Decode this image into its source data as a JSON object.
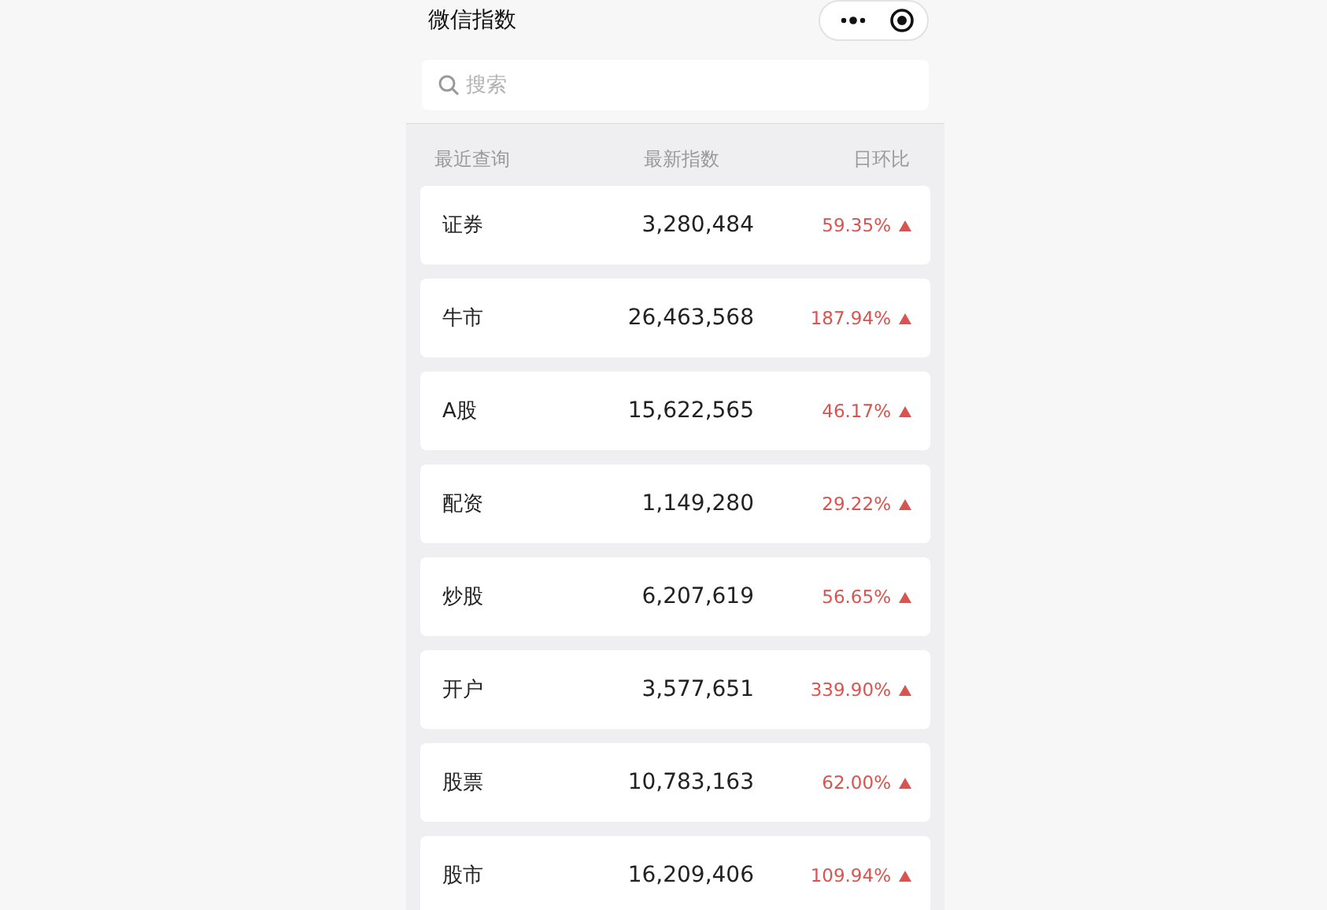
{
  "header": {
    "title": "微信指数"
  },
  "search": {
    "placeholder": "搜索"
  },
  "columns": [
    "最近查询",
    "最新指数",
    "日环比"
  ],
  "rows": [
    {
      "name": "证券",
      "index": "3,280,484",
      "change": "59.35%",
      "kind": "up"
    },
    {
      "name": "牛市",
      "index": "26,463,568",
      "change": "187.94%",
      "kind": "up"
    },
    {
      "name": "A股",
      "index": "15,622,565",
      "change": "46.17%",
      "kind": "up"
    },
    {
      "name": "配资",
      "index": "1,149,280",
      "change": "29.22%",
      "kind": "up"
    },
    {
      "name": "炒股",
      "index": "6,207,619",
      "change": "56.65%",
      "kind": "up"
    },
    {
      "name": "开户",
      "index": "3,577,651",
      "change": "339.90%",
      "kind": "up"
    },
    {
      "name": "股票",
      "index": "10,783,163",
      "change": "62.00%",
      "kind": "up"
    },
    {
      "name": "股市",
      "index": "16,209,406",
      "change": "109.94%",
      "kind": "up"
    }
  ]
}
